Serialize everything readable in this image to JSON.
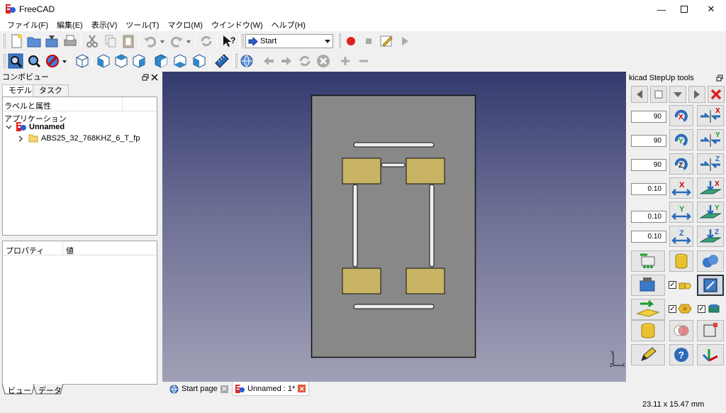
{
  "app": {
    "title": "FreeCAD"
  },
  "menu": [
    "ファイル(F)",
    "編集(E)",
    "表示(V)",
    "ツール(T)",
    "マクロ(M)",
    "ウインドウ(W)",
    "ヘルプ(H)"
  ],
  "workbench": {
    "selected": "Start"
  },
  "combo_view": {
    "title": "コンボビュー",
    "tabs": [
      "モデル",
      "タスク"
    ],
    "labels_header": "ラベルと属性",
    "application": "アプリケーション",
    "document": "Unnamed",
    "child": "ABS25_32_768KHZ_6_T_fp",
    "prop_col1": "プロパティ",
    "prop_col2": "値",
    "bottom_tabs": [
      "ビュー",
      "データ"
    ]
  },
  "stepup": {
    "title": "kicad StepUp tools",
    "rot_values": [
      "90",
      "90",
      "90"
    ],
    "move_values": [
      "0.10",
      "0.10",
      "0.10"
    ]
  },
  "doc_tabs": [
    "Start page",
    "Unnamed : 1*"
  ],
  "status": {
    "dimensions": "23.11 x 15.47 mm"
  },
  "colors": {
    "pad": "#c8b464",
    "board": "#888888",
    "accent": "#cc2222"
  }
}
